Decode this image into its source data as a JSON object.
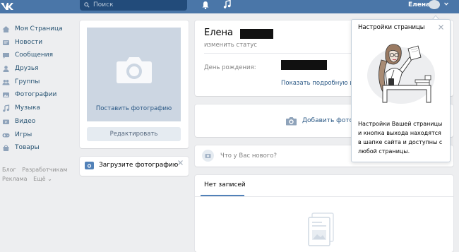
{
  "header": {
    "logo_text": "VK",
    "search_placeholder": "Поиск",
    "user_name": "Елена",
    "colors": {
      "bar": "#4a76a8",
      "search": "#224b7a"
    }
  },
  "leftnav": {
    "items": [
      {
        "label": "Моя Страница",
        "icon": "home-icon"
      },
      {
        "label": "Новости",
        "icon": "news-icon"
      },
      {
        "label": "Сообщения",
        "icon": "messages-icon"
      },
      {
        "label": "Друзья",
        "icon": "friends-icon"
      },
      {
        "label": "Группы",
        "icon": "groups-icon"
      },
      {
        "label": "Фотографии",
        "icon": "photos-icon"
      },
      {
        "label": "Музыка",
        "icon": "music-icon"
      },
      {
        "label": "Видео",
        "icon": "video-icon"
      },
      {
        "label": "Игры",
        "icon": "games-icon"
      },
      {
        "label": "Товары",
        "icon": "goods-icon"
      }
    ],
    "footer": {
      "blog": "Блог",
      "developers": "Разработчикам",
      "ads": "Реклама",
      "more": "Ещё ⌄"
    }
  },
  "photo_card": {
    "set_photo_label": "Поставить фотографию",
    "edit_label": "Редактировать"
  },
  "upload_card": {
    "label": "Загрузите фотографию"
  },
  "profile": {
    "first_name": "Елена",
    "status_placeholder": "изменить статус",
    "birthday_label": "День рождения:",
    "more_info": "Показать подробную ин"
  },
  "add_photo": {
    "label": "Добавить фотогр"
  },
  "compose": {
    "placeholder": "Что у Вас нового?"
  },
  "wall": {
    "tab_label": "Нет записей"
  },
  "tooltip": {
    "title": "Настройки страницы",
    "text": "Настройки Вашей страницы и кнопка выхода находятся в шапке сайта и доступны с любой страницы."
  }
}
